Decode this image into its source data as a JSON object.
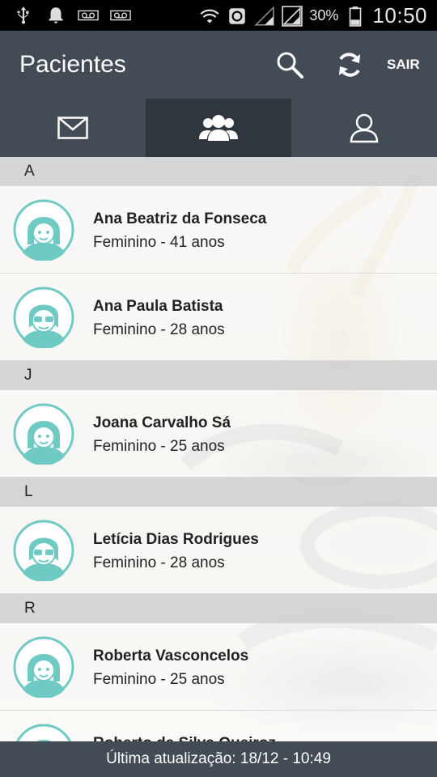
{
  "status_bar": {
    "battery_percent": "30%",
    "time": "10:50",
    "icons": [
      "usb-icon",
      "bell-icon",
      "voicemail-icon",
      "voicemail-icon",
      "wifi-icon",
      "sync-icon",
      "signal-icon",
      "signal-icon",
      "battery-icon"
    ]
  },
  "app_bar": {
    "title": "Pacientes",
    "search_icon": "search-icon",
    "refresh_icon": "refresh-icon",
    "logout_label": "SAIR"
  },
  "tabs": [
    {
      "icon": "mail-icon",
      "active": false
    },
    {
      "icon": "group-icon",
      "active": true
    },
    {
      "icon": "person-icon",
      "active": false
    }
  ],
  "sections": [
    {
      "letter": "A",
      "patients": [
        {
          "name": "Ana Beatriz da Fonseca",
          "info": "Feminino - 41 anos",
          "avatar": "female-avatar-icon"
        },
        {
          "name": "Ana Paula Batista",
          "info": "Feminino - 28 anos",
          "avatar": "female-sunglasses-avatar-icon"
        }
      ]
    },
    {
      "letter": "J",
      "patients": [
        {
          "name": "Joana Carvalho Sá",
          "info": "Feminino - 25 anos",
          "avatar": "female-avatar-icon"
        }
      ]
    },
    {
      "letter": "L",
      "patients": [
        {
          "name": "Letícia Dias Rodrigues",
          "info": "Feminino - 28 anos",
          "avatar": "female-sunglasses-avatar-icon"
        }
      ]
    },
    {
      "letter": "R",
      "patients": [
        {
          "name": "Roberta Vasconcelos",
          "info": "Feminino - 25 anos",
          "avatar": "female-avatar-icon"
        },
        {
          "name": "Roberto da Silva Queiroz",
          "info": "",
          "avatar": "male-avatar-icon"
        }
      ]
    }
  ],
  "footer": {
    "last_update": "Última atualização: 18/12 - 10:49"
  },
  "colors": {
    "app_bar": "#434b55",
    "active_tab": "#2f363e",
    "avatar_teal": "#6fcac4",
    "section_header": "#d2d4d6"
  }
}
